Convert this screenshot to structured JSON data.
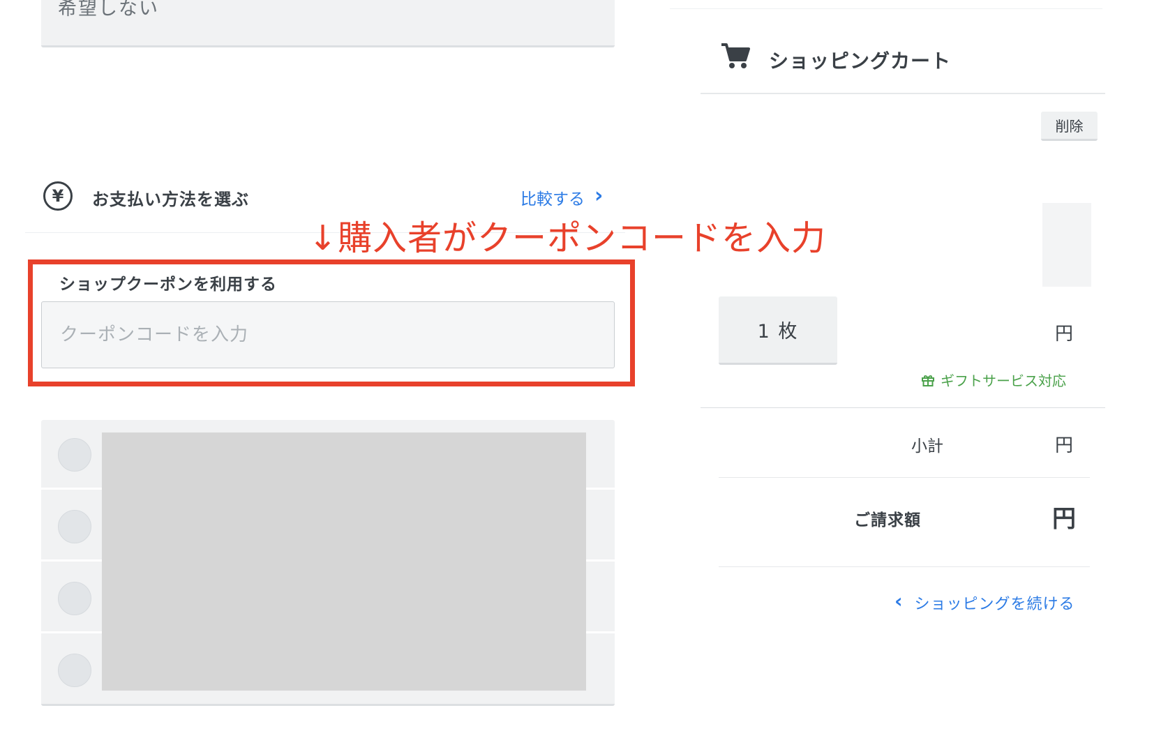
{
  "delivery": {
    "select_value": "希望しない"
  },
  "payment": {
    "title": "お支払い方法を選ぶ",
    "yen_symbol": "¥",
    "compare_link": "比較する",
    "options_count_visible": 4
  },
  "annotation": {
    "text": "↓購入者がクーポンコードを入力",
    "color": "#e8412b"
  },
  "coupon": {
    "label": "ショップクーポンを利用する",
    "placeholder": "クーポンコードを入力",
    "value": ""
  },
  "cart": {
    "title": "ショッピングカート",
    "icon": "cart-icon",
    "delete_label": "削除",
    "quantity": "1 枚",
    "price_unit": "円",
    "gift_service": "ギフトサービス対応",
    "gift_icon": "gift-icon"
  },
  "summary": {
    "subtotal_label": "小計",
    "subtotal_unit": "円",
    "total_label": "ご請求額",
    "total_unit": "円"
  },
  "continue_link": "ショッピングを続ける",
  "colors": {
    "link": "#2c7be5",
    "gift": "#4aa14a",
    "annotation": "#e8412b"
  }
}
